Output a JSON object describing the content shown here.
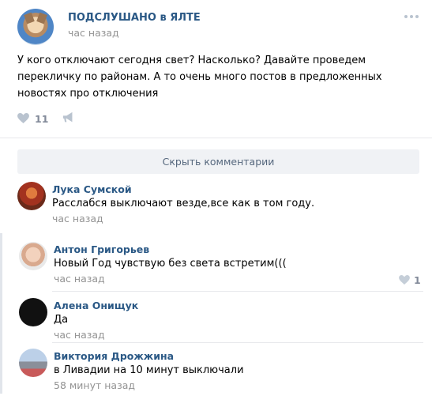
{
  "post": {
    "group_name": "ПОДСЛУШАНО в ЯЛТЕ",
    "time": "час назад",
    "text": "У кого отключают сегодня свет? Насколько? Давайте проведем перекличку по районам. А то очень много постов в предложенных новостях про отключения",
    "likes": "11",
    "more_icon": "more-dots-icon",
    "like_icon": "heart-icon",
    "share_icon": "megaphone-icon"
  },
  "hide_comments_label": "Скрыть комментарии",
  "comments": [
    {
      "author": "Лука Сумской",
      "text": "Расслабся выключают везде,все как в том году.",
      "time": "час назад"
    },
    {
      "author": "Антон Григорьев",
      "text": "Новый Год чувствую без света встретим(((",
      "time": "час назад",
      "likes": "1"
    },
    {
      "author": "Алена Онищук",
      "text": "Да",
      "time": "час назад"
    },
    {
      "author": "Виктория Дрожжина",
      "text": "в Ливадии на 10 минут выключали",
      "time": "58 минут назад"
    }
  ],
  "colors": {
    "link": "#2a5885",
    "muted": "#939393",
    "icon": "#99a6b7",
    "button_bg": "#f0f2f5"
  }
}
